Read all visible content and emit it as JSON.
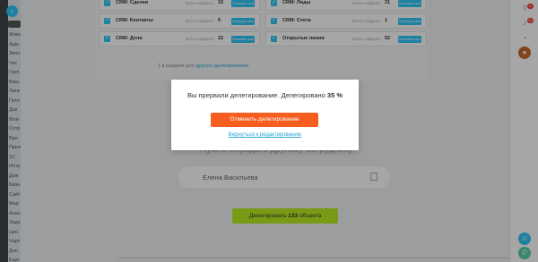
{
  "leftnav": {
    "back_glyph": "‹",
    "items": [
      "Живая",
      "Адм",
      "Звон",
      "Чат",
      "Груп",
      "Ваш",
      "Лаги",
      "Почт",
      "Док",
      "Мои",
      "Сотр",
      "Вре",
      "Прил",
      "1С",
      "Интр",
      "Дож",
      "Бизн",
      "Сайт",
      "Мар",
      "Анал",
      "Зада",
      "Цен",
      "Чарт",
      "Доп",
      "Ещё"
    ]
  },
  "cards": [
    {
      "name": "CRM: Сделки",
      "total_label": "Всего найдено:",
      "count": "15",
      "button": "Показать все"
    },
    {
      "name": "CRM: Лиды",
      "total_label": "Всего найдено:",
      "count": "21",
      "button": "Показать все"
    },
    {
      "name": "CRM: Контакты",
      "total_label": "Всего найдено:",
      "count": "6",
      "button": "Показать все"
    },
    {
      "name": "CRM: Счета",
      "total_label": "Всего найдено:",
      "count": "1",
      "button": "Показать все"
    },
    {
      "name": "CRM: Дела",
      "total_label": "Всего найдено:",
      "count": "22",
      "button": "Показать все"
    },
    {
      "name": "Открытые линии",
      "total_label": "Всего найдено:",
      "count": "52",
      "button": "Показать все"
    }
  ],
  "sub_link": {
    "prefix": "1 в разделе для ",
    "link": "другого делегирования"
  },
  "hint": "Нужно передать другому сотруднику",
  "employee": {
    "name": "Елена Васильева"
  },
  "delegate_button": {
    "prefix": "Делегировать ",
    "count": "133",
    "suffix": " объекта"
  },
  "modal": {
    "message": "Вы прервали делегирование. Делегировано ",
    "percent": "35 %",
    "cancel_label": "Отменить делегирование",
    "back_label": "Вернуться к редактированию"
  },
  "rightbar": {
    "badges": [
      "9",
      "44"
    ],
    "accent": "#2fc6f6"
  },
  "colors": {
    "primary": "#2fc6f6",
    "danger": "#f55e1f",
    "success": "#bbed21"
  }
}
